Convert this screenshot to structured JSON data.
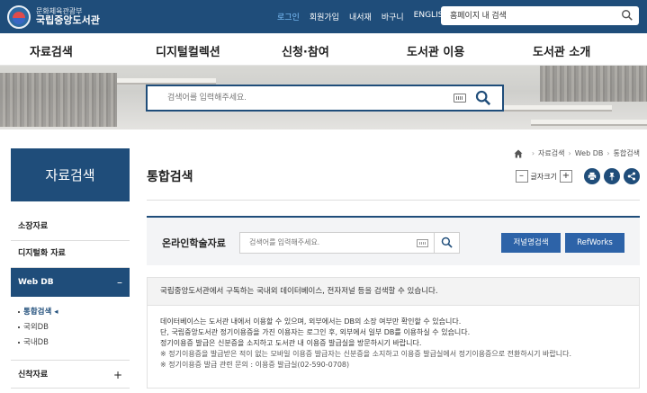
{
  "header": {
    "org_line": "문화체육관광부",
    "site_name": "국립중앙도서관",
    "util_links": [
      "로그인",
      "회원가입",
      "내서재",
      "바구니",
      "ENGLISH"
    ],
    "search_value": "홈페이지 내 검색"
  },
  "gnb": [
    "자료검색",
    "디지털컬렉션",
    "신청·참여",
    "도서관 이용",
    "도서관 소개"
  ],
  "hero": {
    "search_placeholder": "검색어를 입력해주세요."
  },
  "lnb": {
    "title": "자료검색",
    "items": [
      "소장자료",
      "디지털화 자료",
      "Web DB",
      "신착자료"
    ],
    "active_sign": "–",
    "collapsed_sign": "+",
    "sub_items": [
      "통합검색",
      "국외DB",
      "국내DB"
    ]
  },
  "breadcrumb": [
    "자료검색",
    "Web DB",
    "통합검색"
  ],
  "page": {
    "title": "통합검색",
    "font_size_label": "글자크기",
    "minus": "–",
    "plus": "+"
  },
  "online": {
    "label": "온라인학술자료",
    "placeholder": "검색어를 입력해주세요.",
    "journal_button": "저널명검색",
    "refworks_button": "RefWorks"
  },
  "info": {
    "headline": "국립중앙도서관에서 구독하는 국내외 데이터베이스, 전자저널 등을 검색할 수 있습니다.",
    "lines": [
      "데이터베이스는 도서관 내에서 이용할 수 있으며, 외부에서는 DB의 소장 여부만 확인할 수 있습니다.",
      "단, 국립중앙도서관 정기이용증을 가진 이용자는 로그인 후, 외부에서 일부 DB를 이용하실 수 있습니다.",
      "정기이용증 발급은 신분증을 소지하고 도서관 내 이용증 발급실을 방문하시기 바랍니다."
    ],
    "notes": [
      "※ 정기이용증을 발급받은 적이 없는 모바일 이용증 발급자는 신분증을 소지하고 이용증 발급실에서 정기이용증으로 전환하시기 바랍니다.",
      "※ 정기이용증 발급 관련 문의 : 이용증 발급실(02-590-0708)"
    ]
  },
  "colors": {
    "brand_navy": "#1f4d7a",
    "button_blue": "#2d63a8",
    "util_active": "#7fc4ff"
  }
}
